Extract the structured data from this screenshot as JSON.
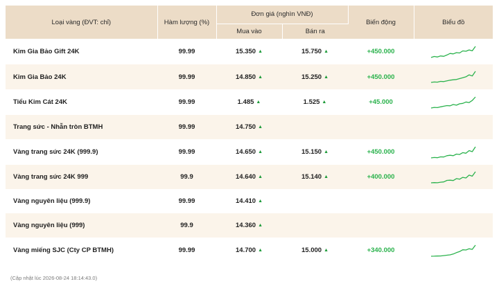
{
  "headers": {
    "type": "Loại vàng (ĐVT: chỉ)",
    "purity": "Hàm lượng (%)",
    "price_group": "Đơn giá (nghìn VNĐ)",
    "buy": "Mua vào",
    "sell": "Bán ra",
    "change": "Biến động",
    "chart": "Biểu đồ"
  },
  "arrow_glyph": "▲",
  "accent_colors": {
    "header_bg": "#ecdcc7",
    "row_alt_bg": "#fbf4ea",
    "up_green": "#2ab24c"
  },
  "rows": [
    {
      "name": "Kim Gia Bảo Gift 24K",
      "purity": "99.99",
      "buy": "15.350",
      "sell": "15.750",
      "change": "+450.000",
      "has_chart": true,
      "spark": [
        10,
        11,
        10.5,
        11.5,
        11.2,
        12.5,
        14,
        13.6,
        14.8,
        14.5,
        16.5,
        16.2,
        17.5,
        16.6,
        21
      ]
    },
    {
      "name": "Kim Gia Bảo 24K",
      "purity": "99.99",
      "buy": "14.850",
      "sell": "15.250",
      "change": "+450.000",
      "has_chart": true,
      "spark": [
        10,
        10.4,
        10.3,
        11,
        10.8,
        11.6,
        12.2,
        12.6,
        12.9,
        13.8,
        14.6,
        15.6,
        17.5,
        16.4,
        21
      ]
    },
    {
      "name": "Tiểu Kim Cát 24K",
      "purity": "99.99",
      "buy": "1.485",
      "sell": "1.525",
      "change": "+45.000",
      "has_chart": true,
      "spark": [
        10,
        10.6,
        10.4,
        11.2,
        11.8,
        12.4,
        12.2,
        13.5,
        12.8,
        14.2,
        14.6,
        16,
        15.4,
        17.5,
        21
      ]
    },
    {
      "name": "Trang sức - Nhẫn tròn BTMH",
      "purity": "99.99",
      "buy": "14.750",
      "sell": "",
      "change": "",
      "has_chart": false,
      "spark": []
    },
    {
      "name": "Vàng trang sức 24K (999.9)",
      "purity": "99.99",
      "buy": "14.650",
      "sell": "15.150",
      "change": "+450.000",
      "has_chart": true,
      "spark": [
        10,
        10.4,
        10.2,
        11,
        10.9,
        12.2,
        12.6,
        12.2,
        13.8,
        13.4,
        15.2,
        14.6,
        17.2,
        16.2,
        21
      ]
    },
    {
      "name": "Vàng trang sức 24K 999",
      "purity": "99.9",
      "buy": "14.640",
      "sell": "15.140",
      "change": "+400.000",
      "has_chart": true,
      "spark": [
        10,
        10.2,
        10.1,
        10.6,
        10.9,
        12.4,
        12.6,
        12.3,
        14.2,
        13.6,
        15.4,
        14.8,
        17.6,
        16.6,
        21
      ]
    },
    {
      "name": "Vàng nguyên liệu (999.9)",
      "purity": "99.99",
      "buy": "14.410",
      "sell": "",
      "change": "",
      "has_chart": false,
      "spark": []
    },
    {
      "name": "Vàng nguyên liệu (999)",
      "purity": "99.9",
      "buy": "14.360",
      "sell": "",
      "change": "",
      "has_chart": false,
      "spark": []
    },
    {
      "name": "Vàng miếng SJC (Cty CP BTMH)",
      "purity": "99.99",
      "buy": "14.700",
      "sell": "15.000",
      "change": "+340.000",
      "has_chart": true,
      "spark": [
        10,
        10.1,
        10.2,
        10.3,
        10.6,
        11,
        11.4,
        12.2,
        13.6,
        14.6,
        16.4,
        16.2,
        17.4,
        16.8,
        21
      ]
    }
  ],
  "footer": "(Cập nhật lúc 2026-08-24 18:14:43.0)"
}
